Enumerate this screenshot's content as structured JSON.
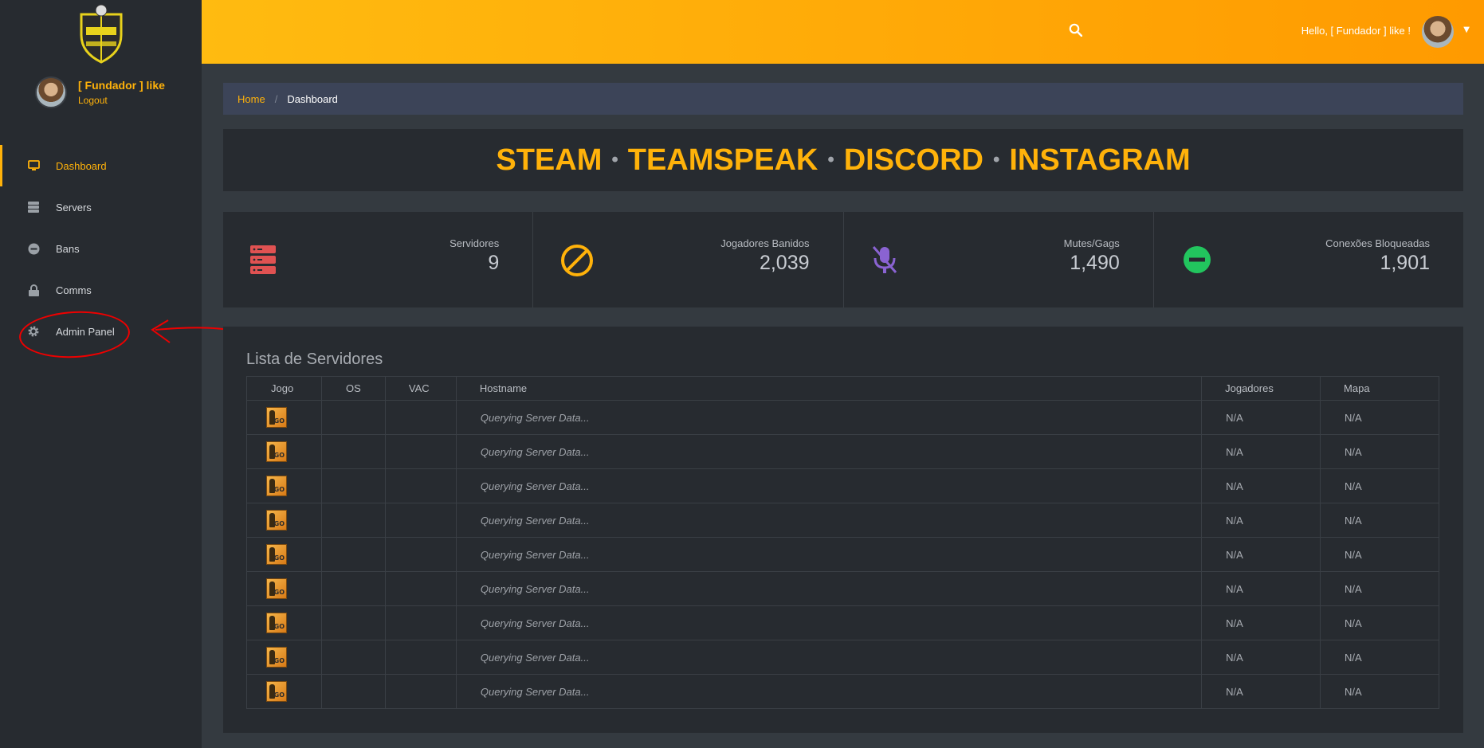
{
  "sidebar": {
    "user_name": "[ Fundador ] like",
    "logout_label": "Logout",
    "nav": [
      {
        "label": "Dashboard",
        "icon": "monitor-icon",
        "active": true
      },
      {
        "label": "Servers",
        "icon": "server-icon",
        "active": false
      },
      {
        "label": "Bans",
        "icon": "minus-circle-icon",
        "active": false
      },
      {
        "label": "Comms",
        "icon": "lock-icon",
        "active": false
      },
      {
        "label": "Admin Panel",
        "icon": "gear-icon",
        "active": false
      }
    ]
  },
  "topbar": {
    "greeting": "Hello, [ Fundador ] like !"
  },
  "breadcrumb": {
    "home": "Home",
    "separator": "/",
    "current": "Dashboard"
  },
  "banner": {
    "items": [
      "STEAM",
      "TEAMSPEAK",
      "DISCORD",
      "INSTAGRAM"
    ],
    "separator": "•"
  },
  "stats": [
    {
      "label": "Servidores",
      "value": "9",
      "icon": "server-stack-icon",
      "color": "#e05252"
    },
    {
      "label": "Jogadores Banidos",
      "value": "2,039",
      "icon": "ban-icon",
      "color": "#ffb20a"
    },
    {
      "label": "Mutes/Gags",
      "value": "1,490",
      "icon": "mic-off-icon",
      "color": "#8a63d2"
    },
    {
      "label": "Conexões Bloqueadas",
      "value": "1,901",
      "icon": "minus-circle-icon",
      "color": "#22c55e"
    }
  ],
  "servers": {
    "title": "Lista de Servidores",
    "columns": [
      "Jogo",
      "OS",
      "VAC",
      "Hostname",
      "Jogadores",
      "Mapa"
    ],
    "rows": [
      {
        "game": "GO",
        "hostname": "Querying Server Data...",
        "players": "N/A",
        "map": "N/A"
      },
      {
        "game": "GO",
        "hostname": "Querying Server Data...",
        "players": "N/A",
        "map": "N/A"
      },
      {
        "game": "GO",
        "hostname": "Querying Server Data...",
        "players": "N/A",
        "map": "N/A"
      },
      {
        "game": "GO",
        "hostname": "Querying Server Data...",
        "players": "N/A",
        "map": "N/A"
      },
      {
        "game": "GO",
        "hostname": "Querying Server Data...",
        "players": "N/A",
        "map": "N/A"
      },
      {
        "game": "GO",
        "hostname": "Querying Server Data...",
        "players": "N/A",
        "map": "N/A"
      },
      {
        "game": "GO",
        "hostname": "Querying Server Data...",
        "players": "N/A",
        "map": "N/A"
      },
      {
        "game": "GO",
        "hostname": "Querying Server Data...",
        "players": "N/A",
        "map": "N/A"
      },
      {
        "game": "GO",
        "hostname": "Querying Server Data...",
        "players": "N/A",
        "map": "N/A"
      }
    ]
  },
  "colors": {
    "accent": "#ffb20a",
    "sidebar_bg": "#272b30",
    "content_bg": "#343a40",
    "annotation": "#e00000"
  }
}
